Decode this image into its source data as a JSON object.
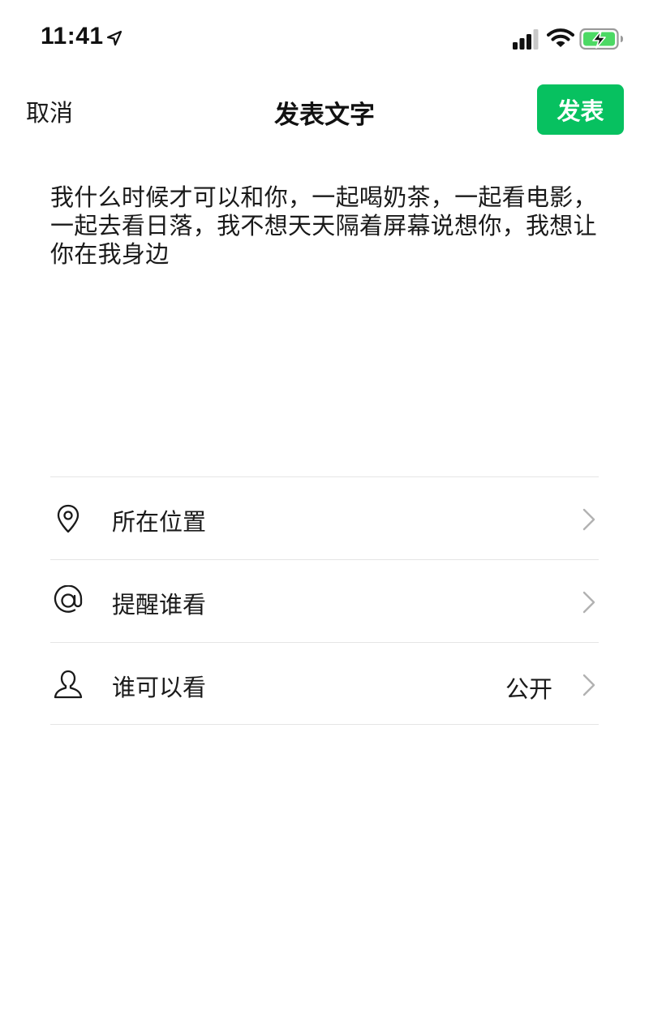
{
  "status_bar": {
    "time": "11:41",
    "icons": [
      "location-arrow-icon",
      "cellular-signal-icon",
      "wifi-icon",
      "battery-charging-icon"
    ],
    "battery_color": "#4cd964"
  },
  "nav": {
    "cancel_label": "取消",
    "title": "发表文字",
    "publish_label": "发表",
    "accent_color": "#07c160"
  },
  "post": {
    "text": "我什么时候才可以和你，一起喝奶茶，一起看电影，一起去看日落，我不想天天隔着屏幕说想你，我想让你在我身边"
  },
  "options": [
    {
      "icon": "location-pin-icon",
      "label": "所在位置",
      "value": ""
    },
    {
      "icon": "at-sign-icon",
      "label": "提醒谁看",
      "value": ""
    },
    {
      "icon": "person-icon",
      "label": "谁可以看",
      "value": "公开"
    }
  ]
}
